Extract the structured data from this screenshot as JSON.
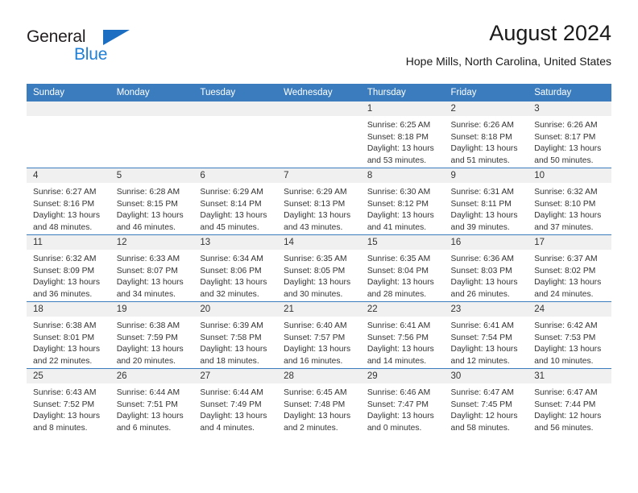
{
  "logo": {
    "line1": "General",
    "line2": "Blue",
    "triangle_color": "#1b6ec2",
    "blue_text_color": "#1f7fd4"
  },
  "header": {
    "month_title": "August 2024",
    "location": "Hope Mills, North Carolina, United States"
  },
  "theme": {
    "header_blue": "#3a7cbe",
    "daynum_band": "#f0f0f0",
    "text": "#333333"
  },
  "calendar": {
    "weekday_headers": [
      "Sunday",
      "Monday",
      "Tuesday",
      "Wednesday",
      "Thursday",
      "Friday",
      "Saturday"
    ],
    "labels": {
      "sunrise_prefix": "Sunrise:",
      "sunset_prefix": "Sunset:",
      "daylight_prefix": "Daylight:"
    },
    "weeks": [
      [
        {
          "day": "",
          "empty": true
        },
        {
          "day": "",
          "empty": true
        },
        {
          "day": "",
          "empty": true
        },
        {
          "day": "",
          "empty": true
        },
        {
          "day": "1",
          "sunrise": "Sunrise: 6:25 AM",
          "sunset": "Sunset: 8:18 PM",
          "daylight_l1": "Daylight: 13 hours",
          "daylight_l2": "and 53 minutes."
        },
        {
          "day": "2",
          "sunrise": "Sunrise: 6:26 AM",
          "sunset": "Sunset: 8:18 PM",
          "daylight_l1": "Daylight: 13 hours",
          "daylight_l2": "and 51 minutes."
        },
        {
          "day": "3",
          "sunrise": "Sunrise: 6:26 AM",
          "sunset": "Sunset: 8:17 PM",
          "daylight_l1": "Daylight: 13 hours",
          "daylight_l2": "and 50 minutes."
        }
      ],
      [
        {
          "day": "4",
          "sunrise": "Sunrise: 6:27 AM",
          "sunset": "Sunset: 8:16 PM",
          "daylight_l1": "Daylight: 13 hours",
          "daylight_l2": "and 48 minutes."
        },
        {
          "day": "5",
          "sunrise": "Sunrise: 6:28 AM",
          "sunset": "Sunset: 8:15 PM",
          "daylight_l1": "Daylight: 13 hours",
          "daylight_l2": "and 46 minutes."
        },
        {
          "day": "6",
          "sunrise": "Sunrise: 6:29 AM",
          "sunset": "Sunset: 8:14 PM",
          "daylight_l1": "Daylight: 13 hours",
          "daylight_l2": "and 45 minutes."
        },
        {
          "day": "7",
          "sunrise": "Sunrise: 6:29 AM",
          "sunset": "Sunset: 8:13 PM",
          "daylight_l1": "Daylight: 13 hours",
          "daylight_l2": "and 43 minutes."
        },
        {
          "day": "8",
          "sunrise": "Sunrise: 6:30 AM",
          "sunset": "Sunset: 8:12 PM",
          "daylight_l1": "Daylight: 13 hours",
          "daylight_l2": "and 41 minutes."
        },
        {
          "day": "9",
          "sunrise": "Sunrise: 6:31 AM",
          "sunset": "Sunset: 8:11 PM",
          "daylight_l1": "Daylight: 13 hours",
          "daylight_l2": "and 39 minutes."
        },
        {
          "day": "10",
          "sunrise": "Sunrise: 6:32 AM",
          "sunset": "Sunset: 8:10 PM",
          "daylight_l1": "Daylight: 13 hours",
          "daylight_l2": "and 37 minutes."
        }
      ],
      [
        {
          "day": "11",
          "sunrise": "Sunrise: 6:32 AM",
          "sunset": "Sunset: 8:09 PM",
          "daylight_l1": "Daylight: 13 hours",
          "daylight_l2": "and 36 minutes."
        },
        {
          "day": "12",
          "sunrise": "Sunrise: 6:33 AM",
          "sunset": "Sunset: 8:07 PM",
          "daylight_l1": "Daylight: 13 hours",
          "daylight_l2": "and 34 minutes."
        },
        {
          "day": "13",
          "sunrise": "Sunrise: 6:34 AM",
          "sunset": "Sunset: 8:06 PM",
          "daylight_l1": "Daylight: 13 hours",
          "daylight_l2": "and 32 minutes."
        },
        {
          "day": "14",
          "sunrise": "Sunrise: 6:35 AM",
          "sunset": "Sunset: 8:05 PM",
          "daylight_l1": "Daylight: 13 hours",
          "daylight_l2": "and 30 minutes."
        },
        {
          "day": "15",
          "sunrise": "Sunrise: 6:35 AM",
          "sunset": "Sunset: 8:04 PM",
          "daylight_l1": "Daylight: 13 hours",
          "daylight_l2": "and 28 minutes."
        },
        {
          "day": "16",
          "sunrise": "Sunrise: 6:36 AM",
          "sunset": "Sunset: 8:03 PM",
          "daylight_l1": "Daylight: 13 hours",
          "daylight_l2": "and 26 minutes."
        },
        {
          "day": "17",
          "sunrise": "Sunrise: 6:37 AM",
          "sunset": "Sunset: 8:02 PM",
          "daylight_l1": "Daylight: 13 hours",
          "daylight_l2": "and 24 minutes."
        }
      ],
      [
        {
          "day": "18",
          "sunrise": "Sunrise: 6:38 AM",
          "sunset": "Sunset: 8:01 PM",
          "daylight_l1": "Daylight: 13 hours",
          "daylight_l2": "and 22 minutes."
        },
        {
          "day": "19",
          "sunrise": "Sunrise: 6:38 AM",
          "sunset": "Sunset: 7:59 PM",
          "daylight_l1": "Daylight: 13 hours",
          "daylight_l2": "and 20 minutes."
        },
        {
          "day": "20",
          "sunrise": "Sunrise: 6:39 AM",
          "sunset": "Sunset: 7:58 PM",
          "daylight_l1": "Daylight: 13 hours",
          "daylight_l2": "and 18 minutes."
        },
        {
          "day": "21",
          "sunrise": "Sunrise: 6:40 AM",
          "sunset": "Sunset: 7:57 PM",
          "daylight_l1": "Daylight: 13 hours",
          "daylight_l2": "and 16 minutes."
        },
        {
          "day": "22",
          "sunrise": "Sunrise: 6:41 AM",
          "sunset": "Sunset: 7:56 PM",
          "daylight_l1": "Daylight: 13 hours",
          "daylight_l2": "and 14 minutes."
        },
        {
          "day": "23",
          "sunrise": "Sunrise: 6:41 AM",
          "sunset": "Sunset: 7:54 PM",
          "daylight_l1": "Daylight: 13 hours",
          "daylight_l2": "and 12 minutes."
        },
        {
          "day": "24",
          "sunrise": "Sunrise: 6:42 AM",
          "sunset": "Sunset: 7:53 PM",
          "daylight_l1": "Daylight: 13 hours",
          "daylight_l2": "and 10 minutes."
        }
      ],
      [
        {
          "day": "25",
          "sunrise": "Sunrise: 6:43 AM",
          "sunset": "Sunset: 7:52 PM",
          "daylight_l1": "Daylight: 13 hours",
          "daylight_l2": "and 8 minutes."
        },
        {
          "day": "26",
          "sunrise": "Sunrise: 6:44 AM",
          "sunset": "Sunset: 7:51 PM",
          "daylight_l1": "Daylight: 13 hours",
          "daylight_l2": "and 6 minutes."
        },
        {
          "day": "27",
          "sunrise": "Sunrise: 6:44 AM",
          "sunset": "Sunset: 7:49 PM",
          "daylight_l1": "Daylight: 13 hours",
          "daylight_l2": "and 4 minutes."
        },
        {
          "day": "28",
          "sunrise": "Sunrise: 6:45 AM",
          "sunset": "Sunset: 7:48 PM",
          "daylight_l1": "Daylight: 13 hours",
          "daylight_l2": "and 2 minutes."
        },
        {
          "day": "29",
          "sunrise": "Sunrise: 6:46 AM",
          "sunset": "Sunset: 7:47 PM",
          "daylight_l1": "Daylight: 13 hours",
          "daylight_l2": "and 0 minutes."
        },
        {
          "day": "30",
          "sunrise": "Sunrise: 6:47 AM",
          "sunset": "Sunset: 7:45 PM",
          "daylight_l1": "Daylight: 12 hours",
          "daylight_l2": "and 58 minutes."
        },
        {
          "day": "31",
          "sunrise": "Sunrise: 6:47 AM",
          "sunset": "Sunset: 7:44 PM",
          "daylight_l1": "Daylight: 12 hours",
          "daylight_l2": "and 56 minutes."
        }
      ]
    ]
  }
}
